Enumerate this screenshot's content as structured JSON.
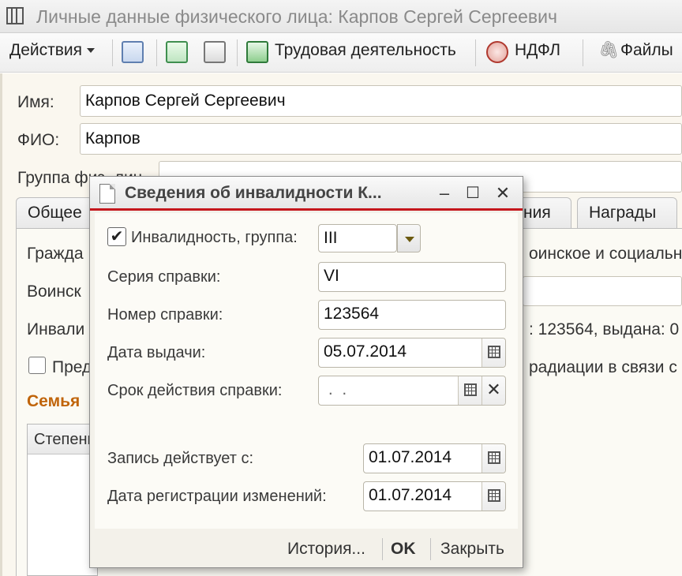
{
  "window": {
    "title": "Личные данные физического лица: Карпов Сергей Сергеевич"
  },
  "toolbar": {
    "actions_label": "Действия",
    "work_label": "Трудовая деятельность",
    "ndfl_label": "НДФЛ",
    "files_label": "Файлы"
  },
  "form": {
    "name_label": "Имя:",
    "name_value": "Карпов Сергей Сергеевич",
    "fio_label": "ФИО:",
    "fio_value": "Карпов",
    "group_label": "Группа физ. лиц",
    "tabs": [
      "Общее",
      "ния",
      "Награды"
    ],
    "citizenship_label": "Гражда",
    "military_label": "Воинск",
    "military_tail": "оинское и социальн",
    "disability_label": "Инвали",
    "disability_tail": ": 123564, выдана: 0",
    "privilege_label": "Пред",
    "radiation_tail": "радиации в связи с",
    "family_title": "Семья",
    "family_col": "Степень"
  },
  "dialog": {
    "title": "Сведения об инвалидности К...",
    "disability_checked": true,
    "disability_label": "Инвалидность, группа:",
    "group_value": "III",
    "series_label": "Серия справки:",
    "series_value": "VI",
    "number_label": "Номер справки:",
    "number_value": "123564",
    "issue_date_label": "Дата выдачи:",
    "issue_date_value": "05.07.2014",
    "validity_label": "Срок действия справки:",
    "validity_value": " .  .",
    "effective_label": "Запись действует с:",
    "effective_value": "01.07.2014",
    "reg_label": "Дата регистрации изменений:",
    "reg_value": "01.07.2014",
    "history_label": "История...",
    "ok_label": "OK",
    "close_label": "Закрыть"
  },
  "colors": {
    "dialog_accent": "#c4161c",
    "family_title": "#c0640a"
  }
}
